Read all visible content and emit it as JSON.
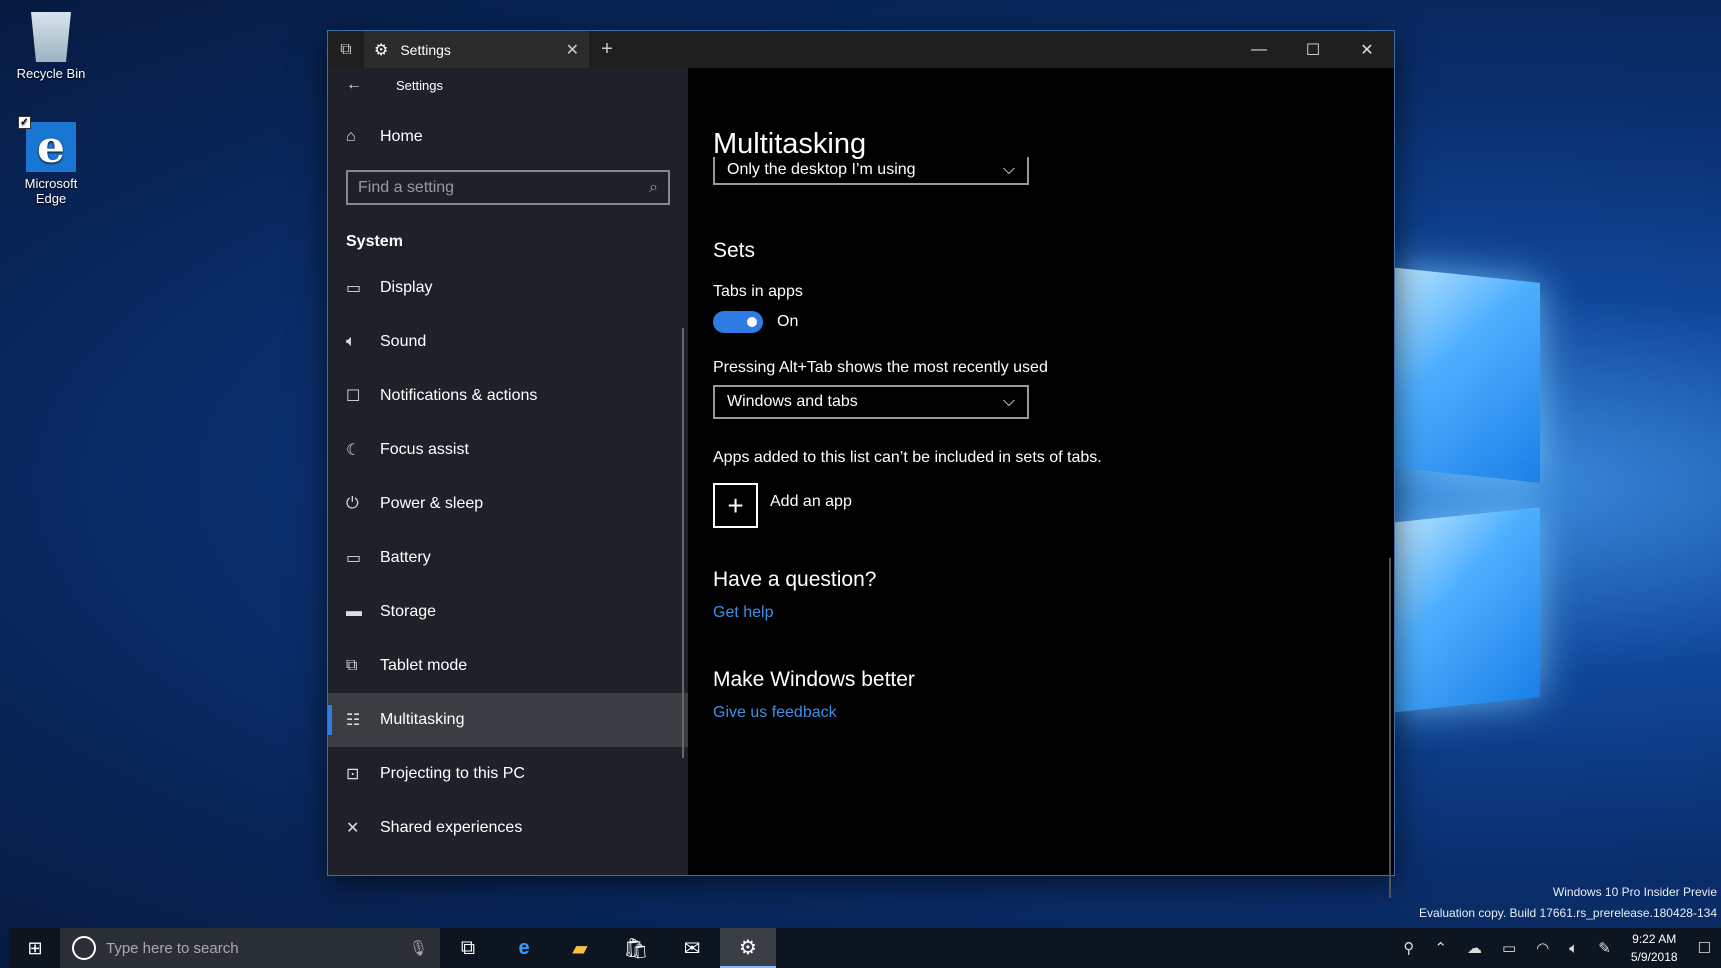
{
  "desktop": {
    "icons": [
      {
        "label": "Recycle Bin"
      },
      {
        "label": "Microsoft Edge"
      }
    ],
    "watermark": {
      "line1": "Windows 10 Pro Insider Previe",
      "line2": "Evaluation copy. Build 17661.rs_prerelease.180428-134"
    }
  },
  "window": {
    "tab_title": "Settings",
    "back_title": "Settings",
    "controls": {
      "minimize": "—",
      "maximize": "☐",
      "close": "✕"
    }
  },
  "sidebar": {
    "home_label": "Home",
    "search_placeholder": "Find a setting",
    "section": "System",
    "items": [
      {
        "label": "Display",
        "icon": "monitor-icon"
      },
      {
        "label": "Sound",
        "icon": "speaker-icon"
      },
      {
        "label": "Notifications & actions",
        "icon": "notification-icon"
      },
      {
        "label": "Focus assist",
        "icon": "moon-icon"
      },
      {
        "label": "Power & sleep",
        "icon": "power-icon"
      },
      {
        "label": "Battery",
        "icon": "battery-icon"
      },
      {
        "label": "Storage",
        "icon": "storage-icon"
      },
      {
        "label": "Tablet mode",
        "icon": "tablet-icon"
      },
      {
        "label": "Multitasking",
        "icon": "multitasking-icon",
        "active": true
      },
      {
        "label": "Projecting to this PC",
        "icon": "projecting-icon"
      },
      {
        "label": "Shared experiences",
        "icon": "shared-icon"
      }
    ]
  },
  "content": {
    "title": "Multitasking",
    "desktop_dropdown_value": "Only the desktop I’m using",
    "sets_heading": "Sets",
    "tabs_label": "Tabs in apps",
    "tabs_toggle_state": "On",
    "alttab_label": "Pressing Alt+Tab shows the most recently used",
    "alttab_value": "Windows and tabs",
    "apps_note": "Apps added to this list can’t be included in sets of tabs.",
    "add_app_label": "Add an app",
    "question_heading": "Have a question?",
    "get_help": "Get help",
    "better_heading": "Make Windows better",
    "feedback": "Give us feedback"
  },
  "taskbar": {
    "search_placeholder": "Type here to search",
    "time": "9:22 AM",
    "date": "5/9/2018"
  },
  "colors": {
    "accent": "#2d7be3",
    "link": "#3d8fe8",
    "sidebar_bg": "#1e2228"
  }
}
